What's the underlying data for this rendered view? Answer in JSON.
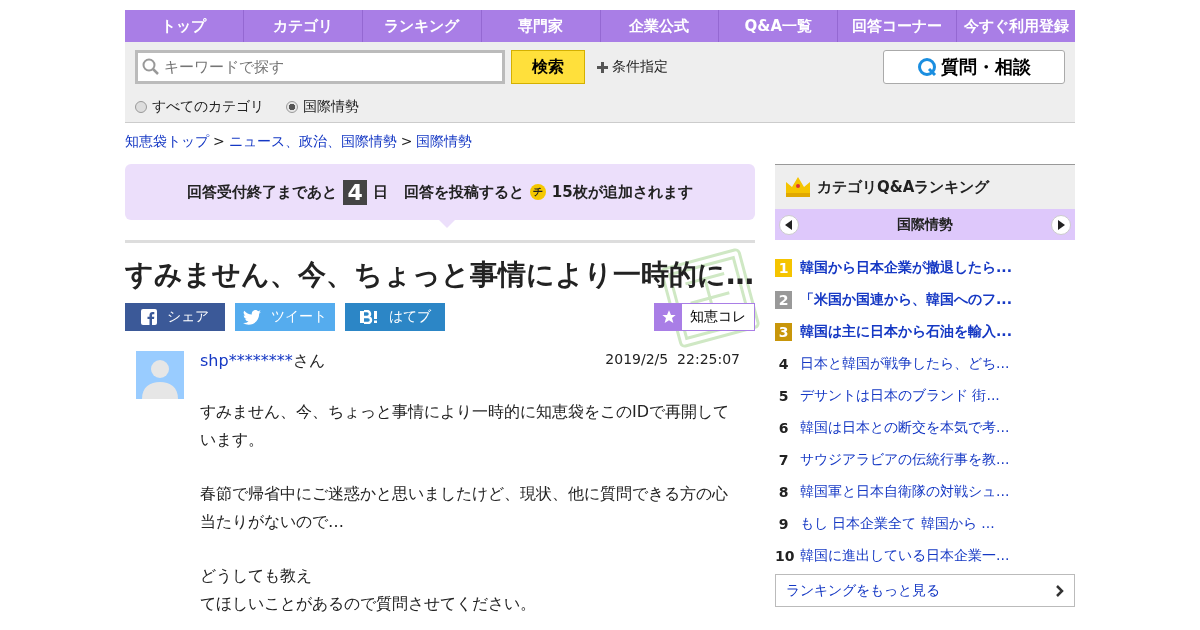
{
  "nav": [
    "トップ",
    "カテゴリ",
    "ランキング",
    "専門家",
    "企業公式",
    "Q&A一覧",
    "回答コーナー",
    "今すぐ利用登録"
  ],
  "search": {
    "placeholder": "キーワードで探す",
    "button": "検索",
    "conditions": "条件指定",
    "ask_button": "質問・相談"
  },
  "scopes": [
    {
      "label": "すべてのカテゴリ",
      "selected": false
    },
    {
      "label": "国際情勢",
      "selected": true
    }
  ],
  "breadcrumb": {
    "separator": ">",
    "items": [
      "知恵袋トップ",
      "ニュース、政治、国際情勢",
      "国際情勢"
    ]
  },
  "notice": {
    "before": "回答受付終了まであと",
    "days": "4",
    "unit": "日",
    "after": "回答を投稿すると",
    "coin": "チ",
    "reward": "15枚が追加されます"
  },
  "question": {
    "title": "すみません、今、ちょっと事情により一時的に…",
    "share": [
      {
        "kind": "facebook",
        "label": "シェア"
      },
      {
        "kind": "twitter",
        "label": "ツイート"
      },
      {
        "kind": "hatena",
        "label": "はてブ"
      }
    ],
    "collect": "知恵コレ",
    "user": "shp********",
    "honorific": "さん",
    "date": "2019/2/5  22:25:07",
    "paragraphs": [
      [
        "すみません、今、ちょっと事情により一時的に知恵袋をこのIDで再開しています。"
      ],
      [
        "春節で帰省中にご迷惑かと思いましたけど、現状、他に質問できる方の心当たりがないので…"
      ],
      [
        "どうしても教え",
        "てほしいことがあるので質問させてください。"
      ]
    ]
  },
  "ranking": {
    "title": "カテゴリQ&Aランキング",
    "category": "国際情勢",
    "more": "ランキングをもっと見る",
    "items": [
      {
        "rank": "1",
        "title": "韓国から日本企業が撤退したら...",
        "color": "#f5c400"
      },
      {
        "rank": "2",
        "title": "「米国か国連から、韓国へのフ...",
        "color": "#999999"
      },
      {
        "rank": "3",
        "title": "韓国は主に日本から石油を輸入...",
        "color": "#c8960a"
      },
      {
        "rank": "4",
        "title": "日本と韓国が戦争したら、どち..."
      },
      {
        "rank": "5",
        "title": "デサントは日本のブランド 街..."
      },
      {
        "rank": "6",
        "title": "韓国は日本との断交を本気で考..."
      },
      {
        "rank": "7",
        "title": "サウジアラビアの伝統行事を教..."
      },
      {
        "rank": "8",
        "title": "韓国軍と日本自衛隊の対戦シュ..."
      },
      {
        "rank": "9",
        "title": "もし 日本企業全て 韓国から ..."
      },
      {
        "rank": "10",
        "title": "韓国に進出している日本企業一..."
      }
    ]
  }
}
